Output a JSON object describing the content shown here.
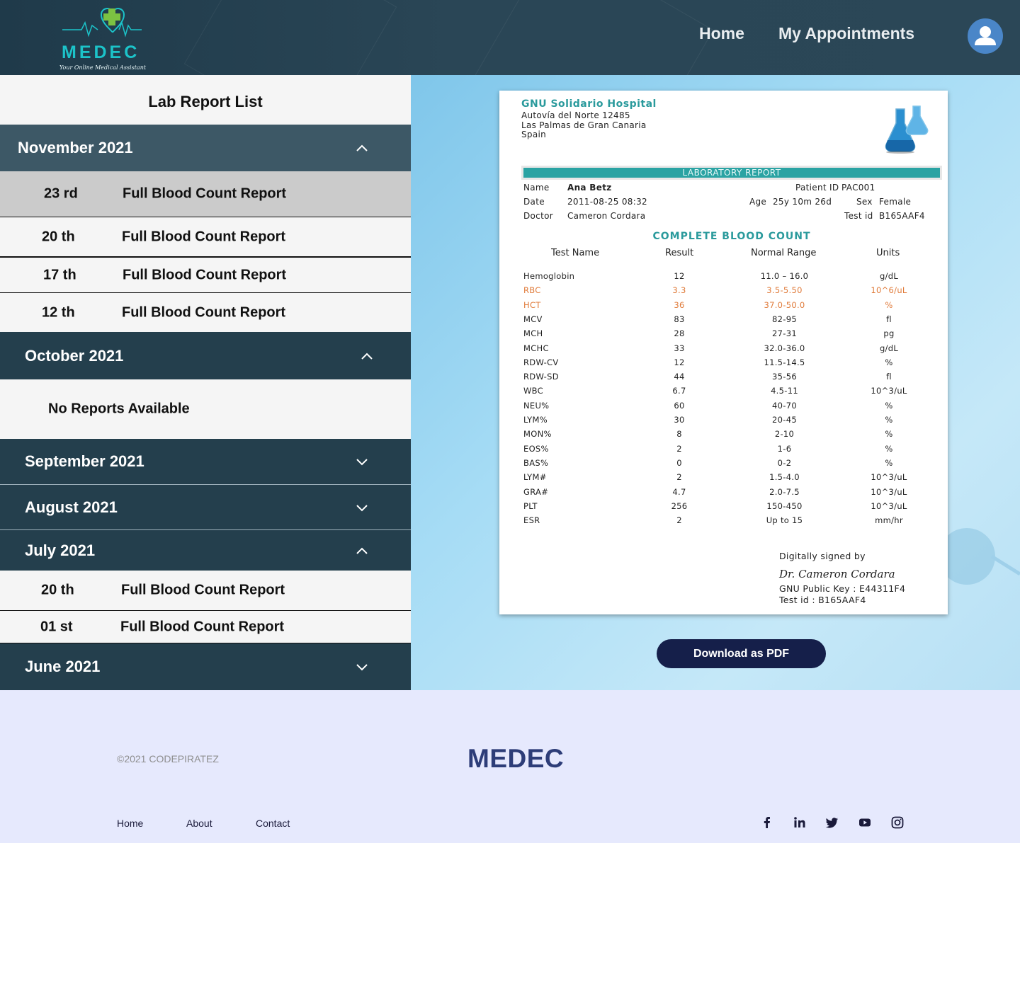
{
  "header": {
    "logo_text": "MEDEC",
    "logo_tagline": "Your Online Medical Assistant",
    "nav": [
      {
        "label": "Home"
      },
      {
        "label": "My Appointments"
      }
    ]
  },
  "sidebar": {
    "title": "Lab Report List",
    "months": [
      {
        "label": "November 2021",
        "expanded": true,
        "reports": [
          {
            "day": "23 rd",
            "name": "Full Blood Count Report",
            "selected": true
          },
          {
            "day": "20 th",
            "name": "Full Blood Count Report"
          },
          {
            "day": "17 th",
            "name": "Full Blood Count Report"
          },
          {
            "day": "12 th",
            "name": "Full Blood Count Report"
          }
        ]
      },
      {
        "label": "October 2021",
        "expanded": true,
        "empty_text": "No Reports Available"
      },
      {
        "label": "September 2021",
        "expanded": false
      },
      {
        "label": "August 2021",
        "expanded": false
      },
      {
        "label": "July 2021",
        "expanded": true,
        "reports": [
          {
            "day": "20 th",
            "name": "Full Blood Count Report"
          },
          {
            "day": "01 st",
            "name": "Full Blood Count Report"
          }
        ]
      },
      {
        "label": "June 2021",
        "expanded": false
      }
    ]
  },
  "report": {
    "hospital": "GNU Solidario Hospital",
    "address": [
      "Autovía del Norte 12485",
      "Las Palmas de Gran Canaria",
      "Spain"
    ],
    "banner": "LABORATORY REPORT",
    "patient": {
      "name_label": "Name",
      "name": "Ana Betz",
      "date_label": "Date",
      "date": "2011-08-25 08:32",
      "doctor_label": "Doctor",
      "doctor": "Cameron Cordara",
      "pid_label": "Patient ID",
      "pid": "PAC001",
      "age_label": "Age",
      "age": "25y 10m 26d",
      "sex_label": "Sex",
      "sex": "Female",
      "testid_label": "Test id",
      "testid": "B165AAF4"
    },
    "section_title": "COMPLETE BLOOD COUNT",
    "columns": [
      "Test Name",
      "Result",
      "Normal Range",
      "Units"
    ],
    "rows": [
      {
        "name": "Hemoglobin",
        "result": "12",
        "range": "11.0 – 16.0",
        "unit": "g/dL"
      },
      {
        "name": "RBC",
        "result": "3.3",
        "range": "3.5-5.50",
        "unit": "10^6/uL",
        "alert": true
      },
      {
        "name": "HCT",
        "result": "36",
        "range": "37.0-50.0",
        "unit": "%",
        "alert": true
      },
      {
        "name": "MCV",
        "result": "83",
        "range": "82-95",
        "unit": "fl"
      },
      {
        "name": "MCH",
        "result": "28",
        "range": "27-31",
        "unit": "pg"
      },
      {
        "name": "MCHC",
        "result": "33",
        "range": "32.0-36.0",
        "unit": "g/dL"
      },
      {
        "name": "RDW-CV",
        "result": "12",
        "range": "11.5-14.5",
        "unit": "%"
      },
      {
        "name": "RDW-SD",
        "result": "44",
        "range": "35-56",
        "unit": "fl"
      },
      {
        "name": "WBC",
        "result": "6.7",
        "range": "4.5-11",
        "unit": "10^3/uL"
      },
      {
        "name": "NEU%",
        "result": "60",
        "range": "40-70",
        "unit": "%"
      },
      {
        "name": "LYM%",
        "result": "30",
        "range": "20-45",
        "unit": "%"
      },
      {
        "name": "MON%",
        "result": "8",
        "range": "2-10",
        "unit": "%"
      },
      {
        "name": "EOS%",
        "result": "2",
        "range": "1-6",
        "unit": "%"
      },
      {
        "name": "BAS%",
        "result": "0",
        "range": "0-2",
        "unit": "%"
      },
      {
        "name": "LYM#",
        "result": "2",
        "range": "1.5-4.0",
        "unit": "10^3/uL"
      },
      {
        "name": "GRA#",
        "result": "4.7",
        "range": "2.0-7.5",
        "unit": "10^3/uL"
      },
      {
        "name": "PLT",
        "result": "256",
        "range": "150-450",
        "unit": "10^3/uL"
      },
      {
        "name": "ESR",
        "result": "2",
        "range": "Up to 15",
        "unit": "mm/hr"
      }
    ],
    "signature": {
      "label": "Digitally signed by",
      "signer": "Dr. Cameron Cordara",
      "key": "GNU Public Key : E44311F4",
      "test_id": "Test id : B165AAF4"
    },
    "download_label": "Download as PDF"
  },
  "footer": {
    "copyright": "©2021 CODEPIRATEZ",
    "logo": "MEDEC",
    "links": [
      "Home",
      "About",
      "Contact"
    ],
    "social_icons": [
      "facebook-icon",
      "linkedin-icon",
      "twitter-icon",
      "youtube-icon",
      "instagram-icon"
    ]
  },
  "colors": {
    "header_bg": "#2a4656",
    "month_active": "#3d5866",
    "month_bg": "#243f4d",
    "row_selected": "#cbcbcb",
    "accent_teal": "#2aa3a3",
    "alert_orange": "#e07b3a",
    "button_navy": "#151f4a",
    "footer_bg": "#e6e9fd"
  }
}
